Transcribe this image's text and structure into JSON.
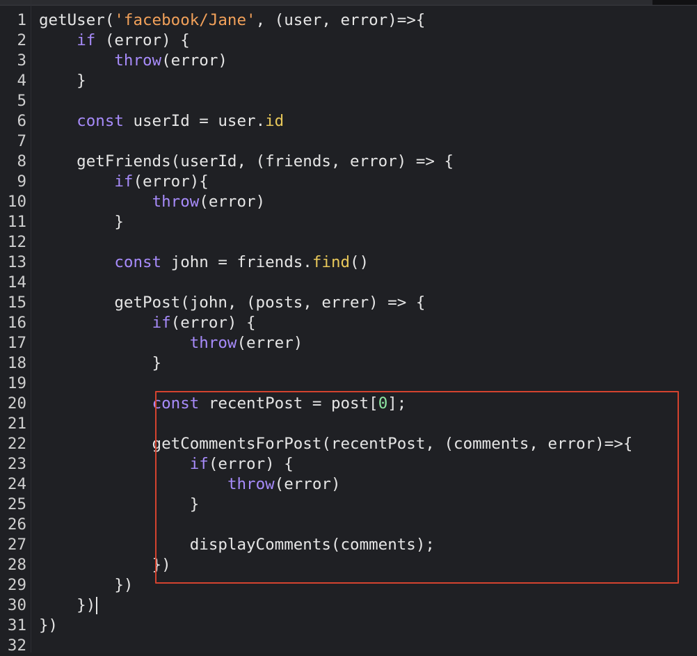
{
  "editor": {
    "line_numbers": [
      "1",
      "2",
      "3",
      "4",
      "5",
      "6",
      "7",
      "8",
      "9",
      "10",
      "11",
      "12",
      "13",
      "14",
      "15",
      "16",
      "17",
      "18",
      "19",
      "20",
      "21",
      "22",
      "23",
      "24",
      "25",
      "26",
      "27",
      "28",
      "29",
      "30",
      "31",
      "32"
    ],
    "lines": [
      [
        {
          "t": "getUser(",
          "c": "plain"
        },
        {
          "t": "'facebook/Jane'",
          "c": "str"
        },
        {
          "t": ", (user, error)=>{",
          "c": "plain"
        }
      ],
      [
        {
          "t": "    ",
          "c": "plain"
        },
        {
          "t": "if",
          "c": "kw"
        },
        {
          "t": " (error) {",
          "c": "plain"
        }
      ],
      [
        {
          "t": "        ",
          "c": "plain"
        },
        {
          "t": "throw",
          "c": "kw"
        },
        {
          "t": "(error)",
          "c": "plain"
        }
      ],
      [
        {
          "t": "    }",
          "c": "plain"
        }
      ],
      [],
      [
        {
          "t": "    ",
          "c": "plain"
        },
        {
          "t": "const",
          "c": "kw"
        },
        {
          "t": " userId = user.",
          "c": "plain"
        },
        {
          "t": "id",
          "c": "prop"
        }
      ],
      [],
      [
        {
          "t": "    getFriends(userId, (friends, error) => {",
          "c": "plain"
        }
      ],
      [
        {
          "t": "        ",
          "c": "plain"
        },
        {
          "t": "if",
          "c": "kw"
        },
        {
          "t": "(error){",
          "c": "plain"
        }
      ],
      [
        {
          "t": "            ",
          "c": "plain"
        },
        {
          "t": "throw",
          "c": "kw"
        },
        {
          "t": "(error)",
          "c": "plain"
        }
      ],
      [
        {
          "t": "        }",
          "c": "plain"
        }
      ],
      [],
      [
        {
          "t": "        ",
          "c": "plain"
        },
        {
          "t": "const",
          "c": "kw"
        },
        {
          "t": " john = friends.",
          "c": "plain"
        },
        {
          "t": "find",
          "c": "prop"
        },
        {
          "t": "()",
          "c": "plain"
        }
      ],
      [],
      [
        {
          "t": "        getPost(john, (posts, errer) => {",
          "c": "plain"
        }
      ],
      [
        {
          "t": "            ",
          "c": "plain"
        },
        {
          "t": "if",
          "c": "kw"
        },
        {
          "t": "(error) {",
          "c": "plain"
        }
      ],
      [
        {
          "t": "                ",
          "c": "plain"
        },
        {
          "t": "throw",
          "c": "kw"
        },
        {
          "t": "(errer)",
          "c": "plain"
        }
      ],
      [
        {
          "t": "            }",
          "c": "plain"
        }
      ],
      [],
      [
        {
          "t": "            ",
          "c": "plain"
        },
        {
          "t": "const",
          "c": "kw"
        },
        {
          "t": " recentPost = post[",
          "c": "plain"
        },
        {
          "t": "0",
          "c": "num"
        },
        {
          "t": "];",
          "c": "plain"
        }
      ],
      [],
      [
        {
          "t": "            getCommentsForPost(recentPost, (comments, error)=>{",
          "c": "plain"
        }
      ],
      [
        {
          "t": "                ",
          "c": "plain"
        },
        {
          "t": "if",
          "c": "kw"
        },
        {
          "t": "(error) {",
          "c": "plain"
        }
      ],
      [
        {
          "t": "                    ",
          "c": "plain"
        },
        {
          "t": "throw",
          "c": "kw"
        },
        {
          "t": "(error)",
          "c": "plain"
        }
      ],
      [
        {
          "t": "                }",
          "c": "plain"
        }
      ],
      [],
      [
        {
          "t": "                displayComments(comments);",
          "c": "plain"
        }
      ],
      [
        {
          "t": "            })",
          "c": "plain"
        }
      ],
      [
        {
          "t": "        })",
          "c": "plain"
        }
      ],
      [
        {
          "t": "    })",
          "c": "plain"
        }
      ],
      [
        {
          "t": "})",
          "c": "plain"
        }
      ],
      []
    ],
    "colors": {
      "background": "#1f2024",
      "keyword": "#a78bfa",
      "string": "#f2a15a",
      "property": "#e8c85a",
      "number": "#8ee6a2",
      "plain": "#e6e6e6",
      "highlight_border": "#d4432f"
    }
  }
}
